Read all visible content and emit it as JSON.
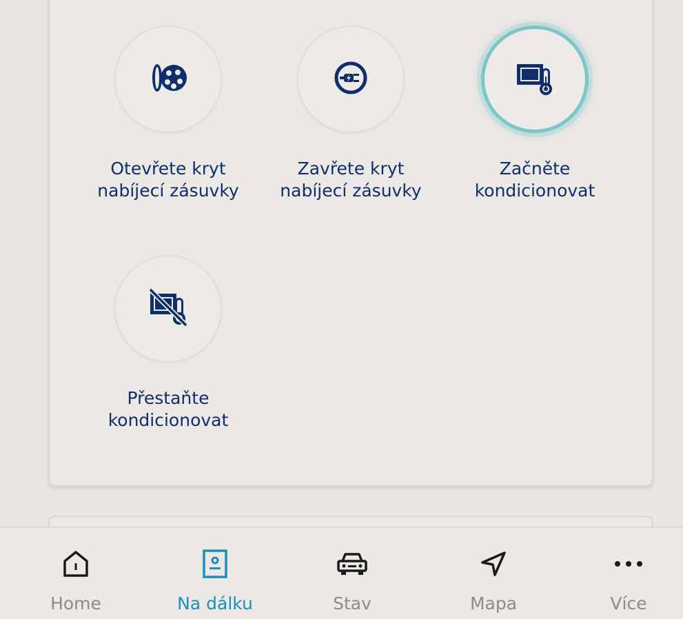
{
  "actions": [
    {
      "label": "Otevřete kryt\nnabíjecí zásuvky",
      "icon": "charge-port-open-icon",
      "active": false
    },
    {
      "label": "Zavřete kryt\nnabíjecí zásuvky",
      "icon": "charge-port-close-icon",
      "active": false
    },
    {
      "label": "Začněte\nkondicionovat",
      "icon": "climate-start-icon",
      "active": true
    },
    {
      "label": "Přestaňte\nkondicionovat",
      "icon": "climate-stop-icon",
      "active": false
    }
  ],
  "nav": {
    "active": "Na dálku",
    "items": [
      {
        "label": "Home",
        "icon": "home-icon"
      },
      {
        "label": "Na dálku",
        "icon": "remote-icon"
      },
      {
        "label": "Stav",
        "icon": "car-icon"
      },
      {
        "label": "Mapa",
        "icon": "navigation-arrow-icon"
      },
      {
        "label": "Více",
        "icon": "more-dots-icon"
      }
    ]
  },
  "colors": {
    "text": "#0e2f6b",
    "accent": "#1a8fbe",
    "active_ring": "#7ac6c9",
    "inactive_nav": "#8d8a87",
    "background": "#eae6e3"
  }
}
